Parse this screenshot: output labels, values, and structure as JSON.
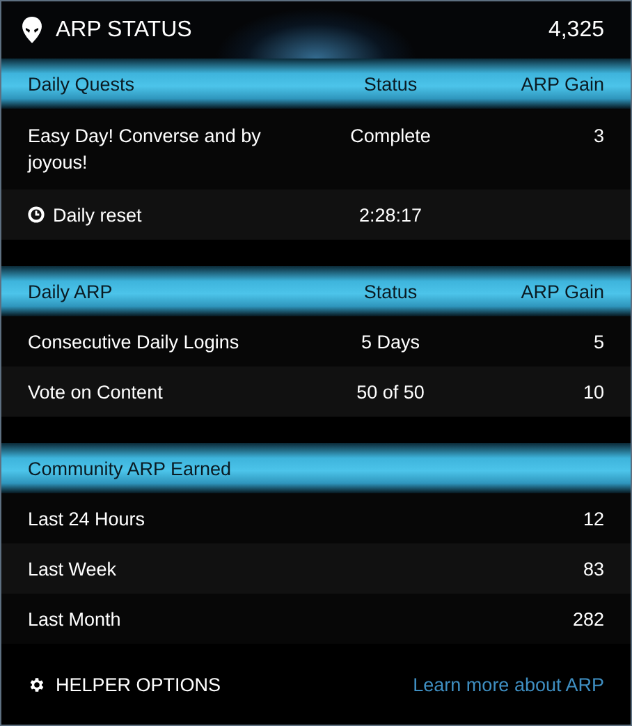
{
  "header": {
    "title": "ARP STATUS",
    "total": "4,325"
  },
  "sections": [
    {
      "title": "Daily Quests",
      "status_heading": "Status",
      "gain_heading": "ARP Gain",
      "rows": [
        {
          "kind": "entry",
          "name": "Easy Day! Converse and by joyous!",
          "status": "Complete",
          "gain": "3"
        },
        {
          "kind": "timer",
          "name": "Daily reset",
          "status": "2:28:17"
        }
      ]
    },
    {
      "title": "Daily ARP",
      "status_heading": "Status",
      "gain_heading": "ARP Gain",
      "rows": [
        {
          "kind": "entry",
          "name": "Consecutive Daily Logins",
          "status": "5 Days",
          "gain": "5"
        },
        {
          "kind": "entry",
          "name": "Vote on Content",
          "status": "50 of 50",
          "gain": "10"
        }
      ]
    },
    {
      "title": "Community ARP Earned",
      "rows": [
        {
          "kind": "entry",
          "name": "Last 24 Hours",
          "gain": "12"
        },
        {
          "kind": "entry",
          "name": "Last Week",
          "gain": "83"
        },
        {
          "kind": "entry",
          "name": "Last Month",
          "gain": "282"
        }
      ]
    }
  ],
  "footer": {
    "options": "HELPER OPTIONS",
    "link": "Learn more about ARP"
  }
}
